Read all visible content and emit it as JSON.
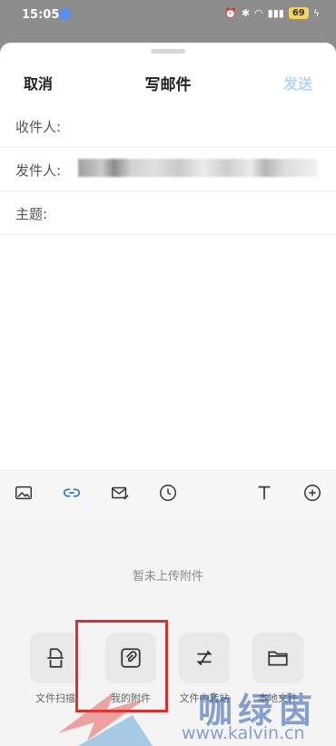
{
  "status": {
    "time": "15:05",
    "battery": "69"
  },
  "compose": {
    "cancel": "取消",
    "title": "写邮件",
    "send": "发送",
    "to_label": "收件人:",
    "from_label": "发件人:",
    "subject_label": "主题:"
  },
  "toolbar": {
    "icons": [
      "image-icon",
      "link-icon",
      "mail-check-icon",
      "clock-icon",
      "text-format-icon",
      "plus-circle-icon"
    ]
  },
  "attachments": {
    "empty_text": "暂未上传附件",
    "items": [
      {
        "label": "文件扫描",
        "icon": "scan-icon"
      },
      {
        "label": "我的附件",
        "icon": "my-attachment-icon"
      },
      {
        "label": "文件中转站",
        "icon": "transfer-icon"
      },
      {
        "label": "本地文件",
        "icon": "folder-icon"
      }
    ]
  },
  "watermark": {
    "text": "咖绿茵",
    "url": "www.kalvin.cn"
  },
  "colors": {
    "send_disabled": "#b6d6f3",
    "link_accent": "#2f6fd6",
    "highlight": "#d9302c"
  }
}
